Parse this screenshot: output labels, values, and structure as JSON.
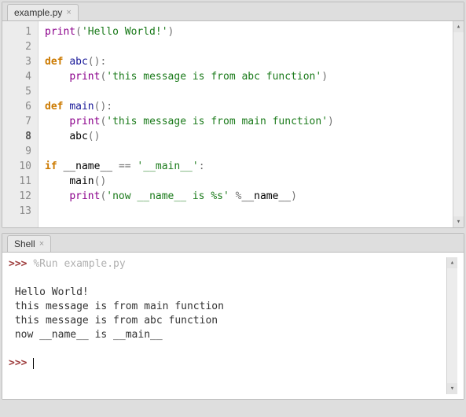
{
  "editor": {
    "tab_label": "example.py",
    "line_count": 13,
    "current_line": 8,
    "lines": [
      [
        {
          "c": "fn",
          "t": "print"
        },
        {
          "c": "par",
          "t": "("
        },
        {
          "c": "str",
          "t": "'Hello World!'"
        },
        {
          "c": "par",
          "t": ")"
        }
      ],
      [],
      [
        {
          "c": "kw",
          "t": "def"
        },
        {
          "c": "",
          "t": " "
        },
        {
          "c": "nm",
          "t": "abc"
        },
        {
          "c": "par",
          "t": "():"
        }
      ],
      [
        {
          "c": "",
          "t": "    "
        },
        {
          "c": "fn",
          "t": "print"
        },
        {
          "c": "par",
          "t": "("
        },
        {
          "c": "str",
          "t": "'this message is from abc function'"
        },
        {
          "c": "par",
          "t": ")"
        }
      ],
      [],
      [
        {
          "c": "kw",
          "t": "def"
        },
        {
          "c": "",
          "t": " "
        },
        {
          "c": "nm",
          "t": "main"
        },
        {
          "c": "par",
          "t": "():"
        }
      ],
      [
        {
          "c": "",
          "t": "    "
        },
        {
          "c": "fn",
          "t": "print"
        },
        {
          "c": "par",
          "t": "("
        },
        {
          "c": "str",
          "t": "'this message is from main function'"
        },
        {
          "c": "par",
          "t": ")"
        }
      ],
      [
        {
          "c": "",
          "t": "    "
        },
        {
          "c": "",
          "t": "abc"
        },
        {
          "c": "par",
          "t": "()"
        }
      ],
      [],
      [
        {
          "c": "kw",
          "t": "if"
        },
        {
          "c": "",
          "t": " __name__ "
        },
        {
          "c": "op",
          "t": "=="
        },
        {
          "c": "",
          "t": " "
        },
        {
          "c": "str",
          "t": "'__main__'"
        },
        {
          "c": "par",
          "t": ":"
        }
      ],
      [
        {
          "c": "",
          "t": "    "
        },
        {
          "c": "",
          "t": "main"
        },
        {
          "c": "par",
          "t": "()"
        }
      ],
      [
        {
          "c": "",
          "t": "    "
        },
        {
          "c": "fn",
          "t": "print"
        },
        {
          "c": "par",
          "t": "("
        },
        {
          "c": "str",
          "t": "'now __name__ is %s'"
        },
        {
          "c": "",
          "t": " "
        },
        {
          "c": "op",
          "t": "%"
        },
        {
          "c": "",
          "t": "__name__"
        },
        {
          "c": "par",
          "t": ")"
        }
      ],
      []
    ]
  },
  "shell": {
    "tab_label": "Shell",
    "prompt": ">>>",
    "run_command": "%Run example.py",
    "output": [
      "Hello World!",
      "this message is from main function",
      "this message is from abc function",
      "now __name__ is __main__"
    ]
  }
}
